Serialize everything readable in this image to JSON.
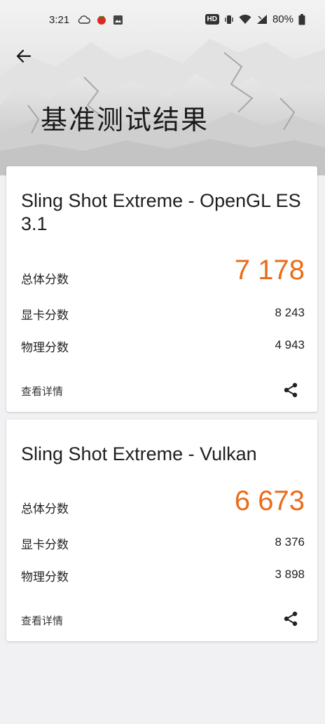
{
  "status_bar": {
    "time": "3:21",
    "hd_badge": "HD",
    "battery_percent": "80%"
  },
  "header": {
    "title": "基准测试结果"
  },
  "results": [
    {
      "test_name": "Sling Shot Extreme - OpenGL ES 3.1",
      "overall_label": "总体分数",
      "overall_score": "7 178",
      "graphics_label": "显卡分数",
      "graphics_score": "8 243",
      "physics_label": "物理分数",
      "physics_score": "4 943",
      "details_label": "查看详情"
    },
    {
      "test_name": "Sling Shot Extreme - Vulkan",
      "overall_label": "总体分数",
      "overall_score": "6 673",
      "graphics_label": "显卡分数",
      "graphics_score": "8 376",
      "physics_label": "物理分数",
      "physics_score": "3 898",
      "details_label": "查看详情"
    }
  ],
  "colors": {
    "score_accent": "#ea6c1a",
    "card_background": "#ffffff",
    "page_background": "#f1f1f4"
  },
  "icons": {
    "back": "arrow-left-icon",
    "share": "share-icon"
  }
}
